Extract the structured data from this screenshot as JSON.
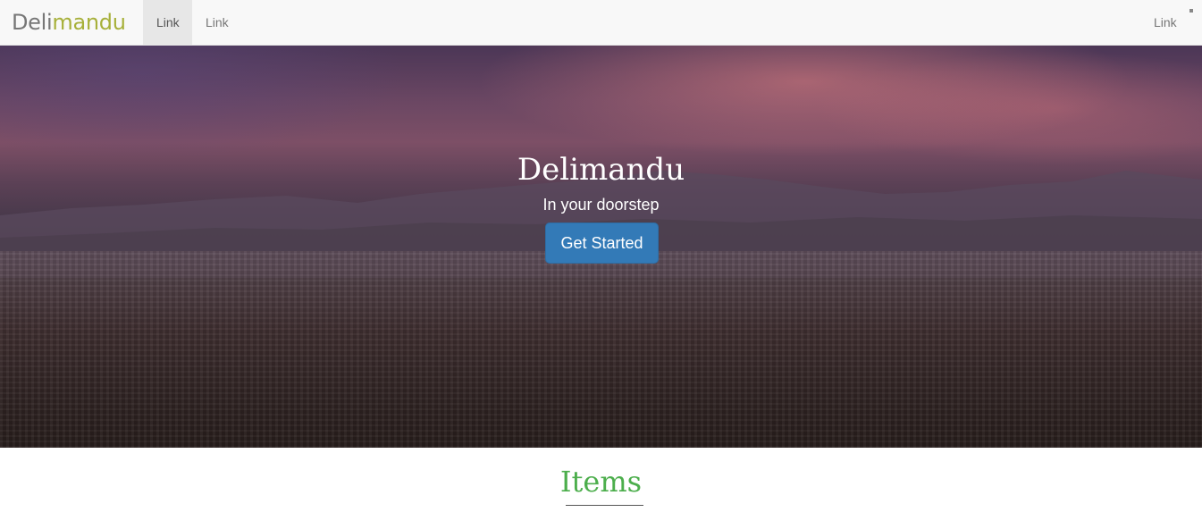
{
  "navbar": {
    "brand_part1": "Deli",
    "brand_part2": "mandu",
    "links": [
      "Link",
      "Link"
    ],
    "right_link": "Link"
  },
  "hero": {
    "title": "Delimandu",
    "subtitle": "In your doorstep",
    "cta_label": "Get Started"
  },
  "section": {
    "title": "Items"
  },
  "colors": {
    "brand_accent": "#a7b03a",
    "primary_button": "#337ab7",
    "section_title": "#4cae4c",
    "navbar_bg": "#f8f8f8"
  }
}
